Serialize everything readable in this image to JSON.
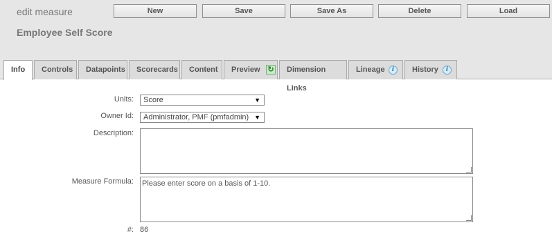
{
  "header": {
    "page_heading": "edit measure",
    "record_title": "Employee Self Score",
    "buttons": [
      {
        "label": "New"
      },
      {
        "label": "Save"
      },
      {
        "label": "Save As"
      },
      {
        "label": "Delete"
      },
      {
        "label": "Load"
      }
    ]
  },
  "tabs": [
    {
      "label": "Info",
      "active": true
    },
    {
      "label": "Controls"
    },
    {
      "label": "Datapoints"
    },
    {
      "label": "Scorecards"
    },
    {
      "label": "Content"
    },
    {
      "label": "Preview",
      "icon": "refresh-icon"
    },
    {
      "label": "Dimension Links"
    },
    {
      "label": "Lineage",
      "icon": "info-icon"
    },
    {
      "label": "History",
      "icon": "info-icon"
    }
  ],
  "form": {
    "units": {
      "label": "Units:",
      "value": "Score"
    },
    "owner": {
      "label": "Owner Id:",
      "value": "Administrator, PMF (pmfadmin)"
    },
    "description": {
      "label": "Description:",
      "value": ""
    },
    "formula": {
      "label": "Measure Formula:",
      "value": "Please enter score on a basis of 1-10."
    },
    "number": {
      "label": "#:",
      "value": "86"
    }
  }
}
